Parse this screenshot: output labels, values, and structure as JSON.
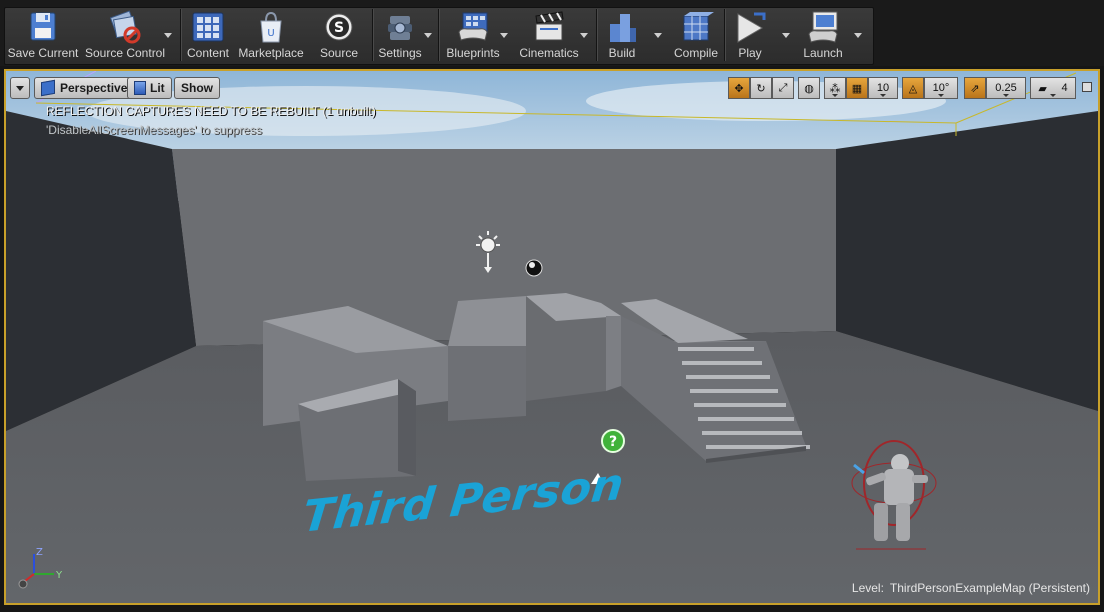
{
  "toolbar": {
    "buttons": [
      {
        "label": "Save Current",
        "icon": "save-icon"
      },
      {
        "label": "Source Control",
        "icon": "source-control-icon"
      },
      {
        "label": "Content",
        "icon": "content-icon"
      },
      {
        "label": "Marketplace",
        "icon": "marketplace-icon"
      },
      {
        "label": "Source",
        "icon": "source-icon"
      },
      {
        "label": "Settings",
        "icon": "settings-icon"
      },
      {
        "label": "Blueprints",
        "icon": "blueprints-icon"
      },
      {
        "label": "Cinematics",
        "icon": "cinematics-icon"
      },
      {
        "label": "Build",
        "icon": "build-icon"
      },
      {
        "label": "Compile",
        "icon": "compile-icon"
      },
      {
        "label": "Play",
        "icon": "play-icon"
      },
      {
        "label": "Launch",
        "icon": "launch-icon"
      }
    ]
  },
  "viewport": {
    "perspective_label": "Perspective",
    "lit_label": "Lit",
    "show_label": "Show",
    "grid_snap_value": "10",
    "rotation_snap_value": "10°",
    "scale_snap_value": "0.25",
    "camera_speed_value": "4",
    "warning": "REFLECTION CAPTURES NEED TO BE REBUILT (1 unbuilt)",
    "warning_sub": "'DisableAllScreenMessages' to suppress",
    "scene_text": "Third Person",
    "level_label": "Level:",
    "level_name": "ThirdPersonExampleMap (Persistent)",
    "axis_z": "Z",
    "axis_y": "Y"
  },
  "colors": {
    "accent": "#c8a02a",
    "scene_text": "#1aa3d6",
    "floor": "#5e6064",
    "wall_back": "#6b6d71",
    "wall_side": "#2b2e33"
  }
}
